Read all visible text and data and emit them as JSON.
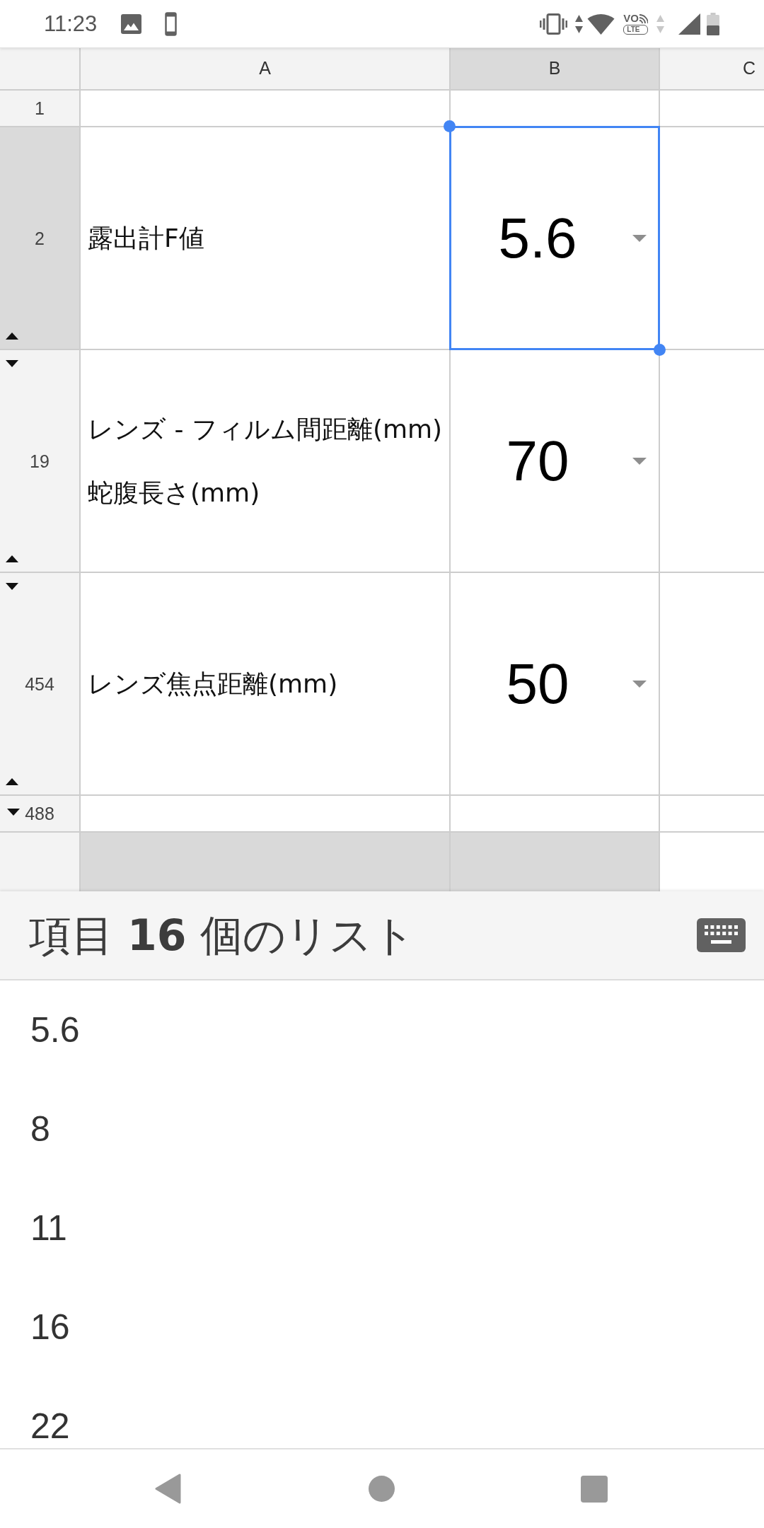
{
  "status_bar": {
    "time": "11:23",
    "network_label": "VO",
    "network_badge": "LTE"
  },
  "sheet": {
    "columns": [
      {
        "label": "A",
        "selected": false
      },
      {
        "label": "B",
        "selected": true
      },
      {
        "label": "C",
        "selected": false
      }
    ],
    "rows": [
      {
        "number": "1",
        "selected": false,
        "hidden_above": false,
        "hidden_below": false
      },
      {
        "number": "2",
        "selected": true,
        "hidden_above": false,
        "hidden_below": true,
        "cells": [
          {
            "kind": "text",
            "text": "露出計F値",
            "selected": false
          },
          {
            "kind": "dropdown",
            "text": "5.6",
            "selected": true
          }
        ]
      },
      {
        "number": "19",
        "selected": false,
        "hidden_above": true,
        "hidden_below": true,
        "cells": [
          {
            "kind": "text",
            "text": "レンズ - フィルム間距離(mm)\n蛇腹長さ(mm)",
            "selected": false
          },
          {
            "kind": "dropdown",
            "text": "70",
            "selected": false
          }
        ]
      },
      {
        "number": "454",
        "selected": false,
        "hidden_above": true,
        "hidden_below": true,
        "cells": [
          {
            "kind": "text",
            "text": "レンズ焦点距離(mm)",
            "selected": false
          },
          {
            "kind": "dropdown",
            "text": "50",
            "selected": false
          }
        ]
      },
      {
        "number": "488",
        "selected": false,
        "hidden_above": true,
        "hidden_below": false
      }
    ]
  },
  "dropdown_list": {
    "title": "項目 **16** 個のリスト",
    "options": [
      "5.6",
      "8",
      "11",
      "16",
      "22"
    ]
  }
}
